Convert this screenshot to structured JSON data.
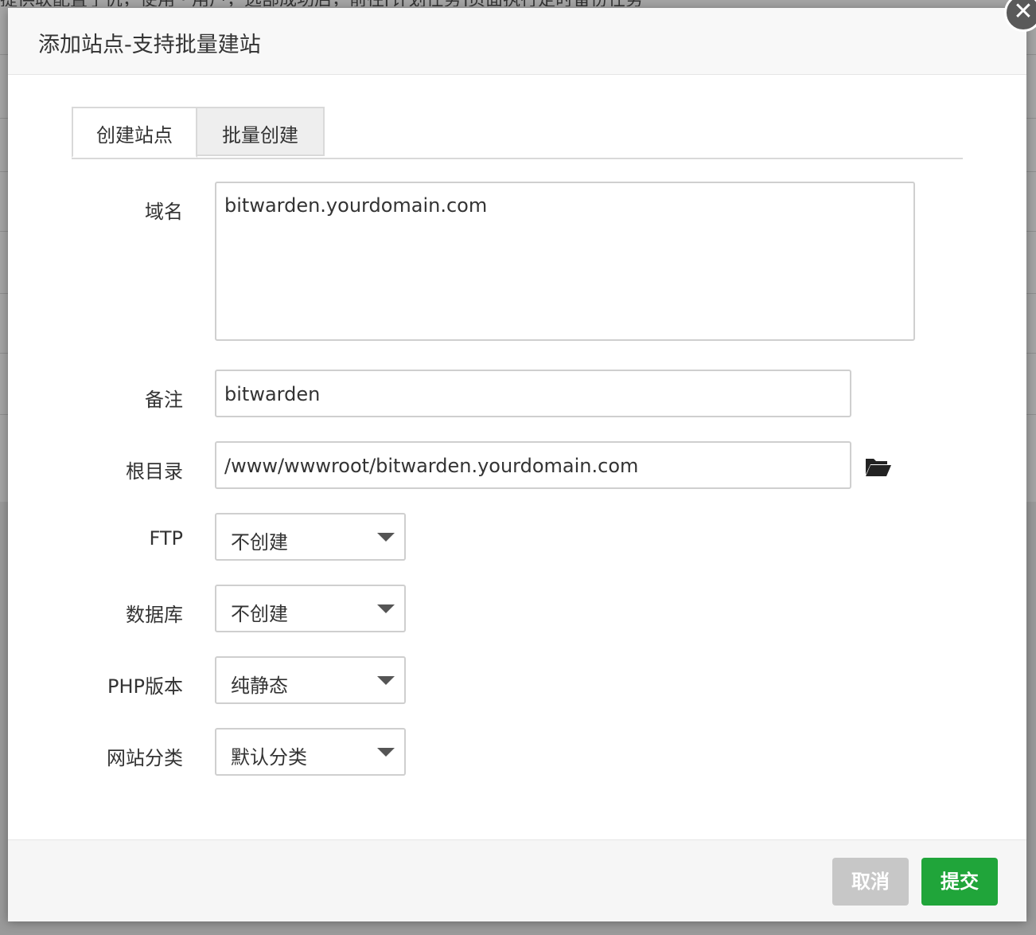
{
  "background": {
    "top_text": "提供联配置了仇，使用  ·  用户，选部成功后，前往[计划任务]页面执行定时备份任务"
  },
  "dialog": {
    "title": "添加站点-支持批量建站",
    "close_symbol": "✕"
  },
  "tabs": [
    {
      "label": "创建站点",
      "active": true
    },
    {
      "label": "批量创建",
      "active": false
    }
  ],
  "form": {
    "domain": {
      "label": "域名",
      "value": "bitwarden.yourdomain.com"
    },
    "remark": {
      "label": "备注",
      "value": "bitwarden"
    },
    "root": {
      "label": "根目录",
      "value": "/www/wwwroot/bitwarden.yourdomain.com",
      "icon": "folder-open-icon"
    },
    "ftp": {
      "label": "FTP",
      "selected": "不创建"
    },
    "database": {
      "label": "数据库",
      "selected": "不创建"
    },
    "php": {
      "label": "PHP版本",
      "selected": "纯静态"
    },
    "category": {
      "label": "网站分类",
      "selected": "默认分类"
    }
  },
  "footer": {
    "cancel_label": "取消",
    "submit_label": "提交"
  },
  "colors": {
    "submit": "#20a53a",
    "cancel": "#c7c7c7"
  }
}
